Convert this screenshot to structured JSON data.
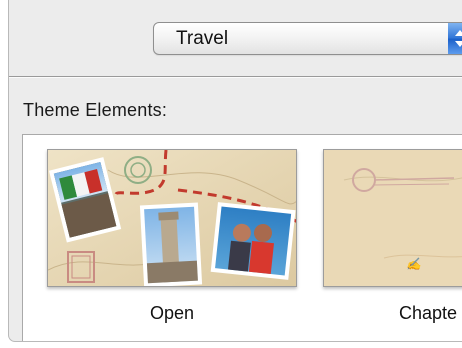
{
  "theme_popup": {
    "selected": "Travel"
  },
  "theme_elements": {
    "label": "Theme Elements:",
    "items": [
      {
        "caption": "Open"
      },
      {
        "caption": "Chapte"
      }
    ]
  },
  "colors": {
    "panel_bg": "#ececec",
    "popup_accent": "#2f74d6",
    "paper": "#e7d8b5",
    "stamp_red": "#c23a2d"
  },
  "icons": {
    "popup_arrows": "up-down-arrows-icon"
  }
}
